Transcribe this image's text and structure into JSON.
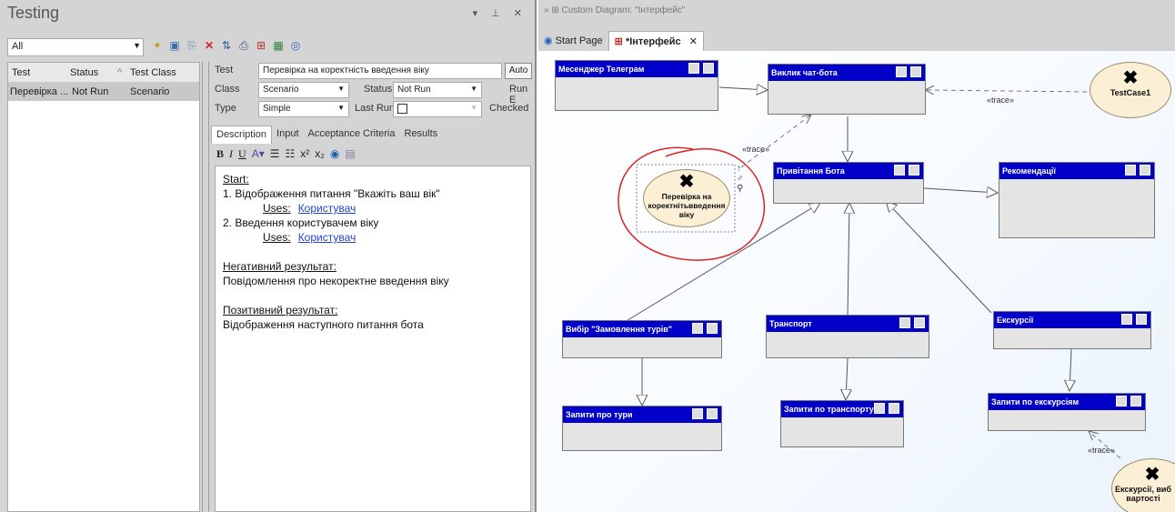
{
  "left": {
    "title": "Testing",
    "window_controls": "▾ ⊥ ✕",
    "filter": "All",
    "toolbar_icons": [
      "new-icon",
      "save-icon",
      "copy-icon",
      "delete-icon",
      "sort-icon",
      "print-icon",
      "diagram-icon",
      "report-icon",
      "help-icon"
    ],
    "columns": [
      "Test",
      "Status",
      "^",
      "Test Class"
    ],
    "rows": [
      {
        "test": "Перевірка ...",
        "status": "Not Run",
        "class": "Scenario"
      }
    ]
  },
  "detail": {
    "test_label": "Test",
    "test_value": "Перевірка на коректність введення віку",
    "auto_label": "Auto",
    "class_label": "Class",
    "class_value": "Scenario",
    "status_label": "Status:",
    "status_value": "Not Run",
    "run_label": "Run E",
    "type_label": "Type",
    "type_value": "Simple",
    "lastrun_label": "Last Run:",
    "checked_label": "Checked",
    "tabs": [
      "Description",
      "Input",
      "Acceptance Criteria",
      "Results"
    ],
    "format_buttons": [
      "B",
      "I",
      "U",
      "A▾",
      "☰",
      "☷",
      "x²",
      "x₂",
      "◉",
      "▤"
    ],
    "editor": {
      "start": "Start:",
      "step1": "1. Відображення питання \"Вкажіть ваш вік\"",
      "uses1": "Uses:",
      "link1": "Користувач",
      "step2": "2. Введення користувачем віку",
      "uses2": "Uses:",
      "link2": "Користувач",
      "neg_head": "Негативний результат:",
      "neg_text": "Повідомлення про некоректне введення віку",
      "pos_head": "Позитивний результат:",
      "pos_text": "Відображення наступного питання бота"
    }
  },
  "right": {
    "title": "» ⊞   Custom Diagram: \"Інтерфейс\"",
    "tabs": [
      {
        "label": "Start Page"
      },
      {
        "label": "*Інтерфейс"
      }
    ],
    "close": "✕",
    "classes": {
      "messenger": "Месенджер Телеграм",
      "call": "Виклик чат-бота",
      "greet": "Привітання Бота",
      "recs": "Рекомендації",
      "tours": "Вибір \"Замовлення турів\"",
      "transport": "Транспорт",
      "excursions": "Екскурсії",
      "q_tours": "Запити про тури",
      "q_transport": "Запити по транспорту",
      "q_excursions": "Запити по екскурсіям"
    },
    "testcases": {
      "tc1": "TestCase1",
      "age": "Перевірка на коректнітьвведення віку",
      "exc": "Екскурсії, виб вартості"
    },
    "trace": "«trace»",
    "annotation_color": "#e02020",
    "header_color": "#0000c8"
  }
}
